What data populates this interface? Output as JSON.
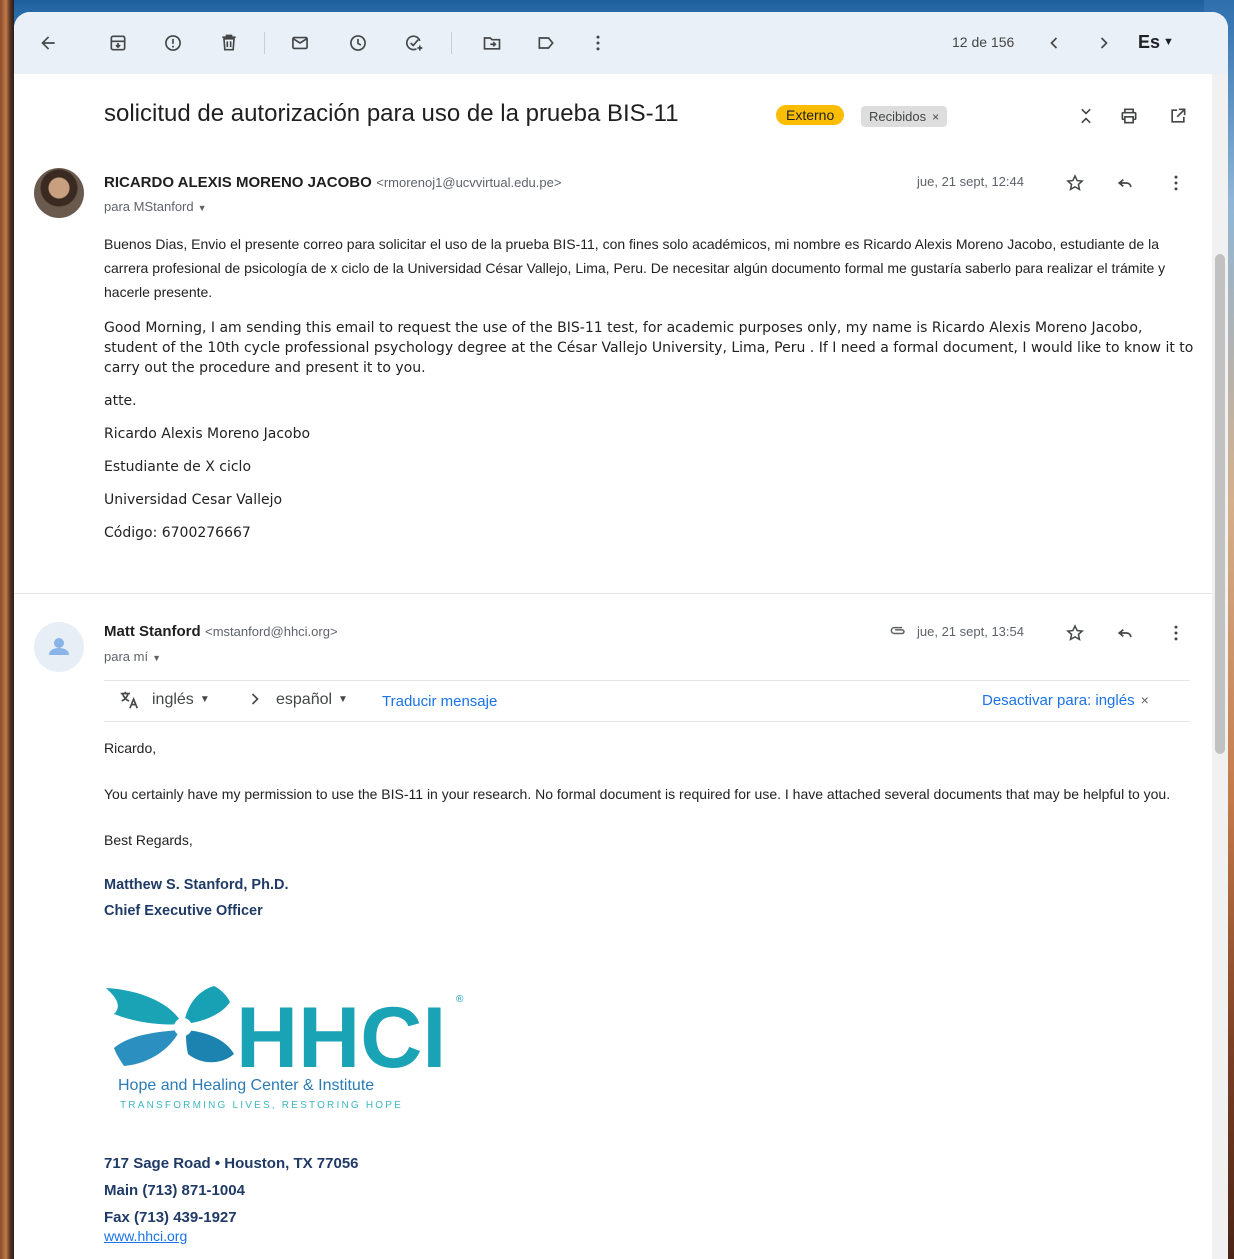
{
  "toolbar": {
    "count": "12 de 156",
    "lang": "Es"
  },
  "subject": {
    "title": "solicitud de autorización para uso de la prueba BIS-11",
    "label_external": "Externo",
    "label_inbox": "Recibidos",
    "label_close": "×"
  },
  "message1": {
    "sender_name": "RICARDO ALEXIS MORENO JACOBO",
    "sender_email": "<rmorenoj1@ucvvirtual.edu.pe>",
    "to": "para MStanford",
    "date": "jue, 21 sept, 12:44",
    "body_es": " Buenos Dias, Envio el presente correo para solicitar el uso de la prueba BIS-11, con fines solo académicos, mi nombre es Ricardo Alexis Moreno Jacobo, estudiante de la carrera profesional de psicología de x ciclo de la Universidad César Vallejo, Lima, Peru. De necesitar algún documento formal me gustaría saberlo para realizar el trámite y hacerle presente.",
    "body_en": "Good Morning, I am sending this email to request the use of the BIS-11 test, for academic purposes only, my name is Ricardo Alexis Moreno Jacobo, student of the 10th cycle professional psychology degree at the César Vallejo University, Lima, Peru . If I need a formal document, I would like to know it to carry out the procedure and present it to you.",
    "sig_lines": [
      "atte.",
      "Ricardo Alexis Moreno Jacobo",
      "Estudiante de X ciclo",
      "Universidad Cesar Vallejo",
      "Código: 6700276667"
    ]
  },
  "message2": {
    "sender_name": "Matt Stanford",
    "sender_email": "<mstanford@hhci.org>",
    "to": "para mí",
    "date": "jue, 21 sept, 13:54",
    "translate": {
      "from": "inglés",
      "to": "español",
      "action": "Traducir mensaje",
      "disable": "Desactivar para: inglés",
      "close": "×"
    },
    "greeting": "Ricardo,",
    "body": "You certainly have my permission to use the BIS-11 in your research. No formal document is required for use. I have attached several documents that may be helpful to you.",
    "closing": "Best Regards,",
    "sig_name": "Matthew S. Stanford, Ph.D.",
    "sig_title": "Chief Executive Officer",
    "logo": {
      "wordmark": "HHCI",
      "registered": "®",
      "org_name": "Hope and Healing Center & Institute",
      "tagline": "TRANSFORMING LIVES, RESTORING HOPE"
    },
    "address": "717 Sage Road • Houston, TX 77056",
    "phone_main": "Main (713) 871-1004",
    "phone_fax": "Fax (713) 439-1927",
    "website": "www.hhci.org"
  },
  "colors": {
    "toolbar_bg": "#e9f0f8",
    "label_external": "#fbbc04",
    "link": "#1a73e8",
    "signature": "#1f3a66",
    "logo_teal": "#1aa3b5",
    "logo_navy": "#15466e"
  }
}
